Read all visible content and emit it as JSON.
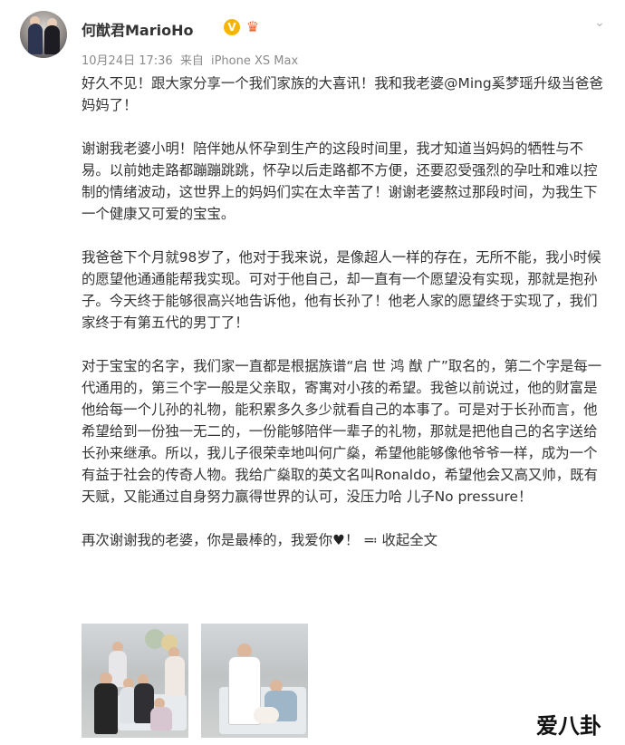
{
  "post": {
    "username": "何猷君MarioHo",
    "verified_icon": "verified-v-icon",
    "member_icon": "member-crown-icon",
    "menu_icon": "chevron-down-icon",
    "date": "10月24日 17:36",
    "source_prefix": "来自",
    "source": "iPhone XS Max",
    "paragraphs": [
      "好久不见！跟大家分享一个我们家族的大喜讯！我和我老婆@Ming奚梦瑶升级当爸爸妈妈了！",
      "谢谢我老婆小明！陪伴她从怀孕到生产的这段时间里，我才知道当妈妈的牺牲与不易。以前她走路都蹦蹦跳跳，怀孕以后走路都不方便，还要忍受强烈的孕吐和难以控制的情绪波动，这世界上的妈妈们实在太辛苦了！谢谢老婆熬过那段时间，为我生下一个健康又可爱的宝宝。",
      "我爸爸下个月就98岁了，他对于我来说，是像超人一样的存在，无所不能，我小时候的愿望他通通能帮我实现。可对于他自己，却一直有一个愿望没有实现，那就是抱孙子。今天终于能够很高兴地告诉他，他有长孙了！他老人家的愿望终于实现了，我们家终于有第五代的男丁了！",
      "对于宝宝的名字，我们家一直都是根据族谱“启 世 鸿 猷 广”取名的，第二个字是每一代通用的，第三个字一般是父亲取，寄寓对小孩的希望。我爸以前说过，他的财富是他给每一个儿孙的礼物，能积累多久多少就看自己的本事了。可是对于长孙而言，他希望给到一份独一无二的，一份能够陪伴一辈子的礼物，那就是把他自己的名字送给长孙来继承。所以，我儿子很荣幸地叫何广燊，希望他能够像他爷爷一样，成为一个有益于社会的传奇人物。我给广燊取的英文名叫Ronaldo，希望他会又高又帅，既有天赋，又能通过自身努力赢得世界的认可，没压力哈 儿子No pressure！"
    ],
    "closing_text": "再次谢谢我的老婆，你是最棒的，我爱你",
    "closing_heart": "♥",
    "closing_punct": "！",
    "collapse_icon": "collapse-up-icon",
    "collapse_label": "收起全文",
    "photos": [
      {
        "name": "family-photo-hospital-group"
      },
      {
        "name": "family-photo-mother-baby"
      }
    ]
  },
  "watermark": "爱八卦",
  "colors": {
    "text": "#333333",
    "meta": "#8a8a8a",
    "verified": "#f7b500",
    "crown": "#e8622b"
  }
}
